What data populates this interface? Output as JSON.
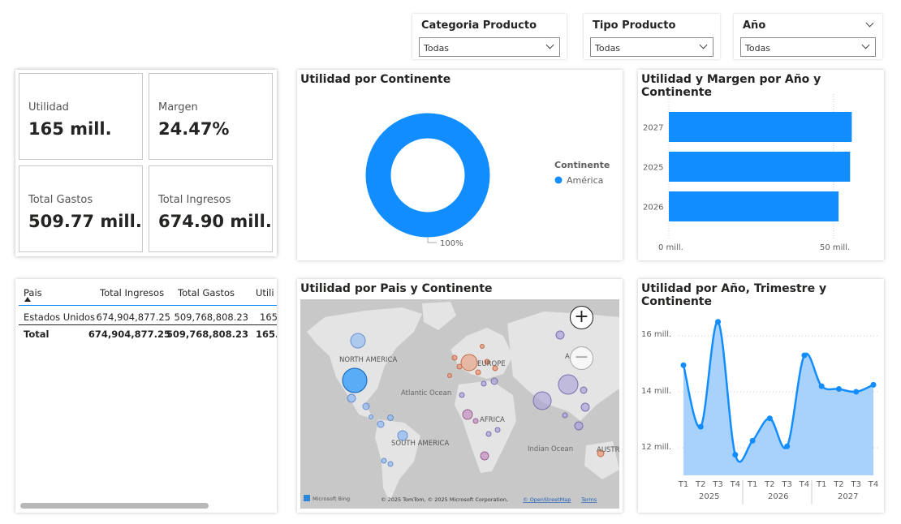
{
  "slicers": [
    {
      "title": "Categoria Producto",
      "value": "Todas"
    },
    {
      "title": "Tipo Producto",
      "value": "Todas"
    },
    {
      "title": "Año",
      "value": "Todas"
    }
  ],
  "kpis": [
    {
      "label": "Utilidad",
      "value": "165 mill."
    },
    {
      "label": "Margen",
      "value": "24.47%"
    },
    {
      "label": "Total Gastos",
      "value": "509.77 mill."
    },
    {
      "label": "Total Ingresos",
      "value": "674.90 mill."
    }
  ],
  "donut": {
    "title": "Utilidad por Continente",
    "legend_title": "Continente",
    "legend_item": "América",
    "pct_label": "100%"
  },
  "bar_chart": {
    "title": "Utilidad y Margen por Año y Continente",
    "x_tick_0": "0 mill.",
    "x_tick_50": "50 mill."
  },
  "table": {
    "headers": [
      "Pais",
      "Total Ingresos",
      "Total Gastos",
      "Utili"
    ],
    "row": [
      "Estados Unidos",
      "674,904,877.25",
      "509,768,808.23",
      "165"
    ],
    "total": [
      "Total",
      "674,904,877.25",
      "509,768,808.23",
      "165."
    ]
  },
  "map": {
    "title": "Utilidad por Pais y Continente",
    "labels": {
      "north_america": "NORTH AMERICA",
      "europe": "EUROPE",
      "atlantic": "Atlantic Ocean",
      "africa": "AFRICA",
      "south_america": "SOUTH AMERICA",
      "indian": "Indian Ocean",
      "austr": "AUSTR",
      "asia_partial": "A"
    },
    "bing": "Microsoft Bing",
    "copyright": "© 2025 TomTom, © 2025 Microsoft Corporation,",
    "osm": "© OpenStreetMap",
    "terms": "Terms"
  },
  "line_chart": {
    "title": "Utilidad por Año, Trimestre y Continente",
    "y_ticks": [
      "16 mill.",
      "14 mill.",
      "12 mill."
    ],
    "quarters": [
      "T1",
      "T2",
      "T3",
      "T4",
      "T1",
      "T2",
      "T3",
      "T4",
      "T1",
      "T2",
      "T3",
      "T4"
    ],
    "years": [
      "2025",
      "2026",
      "2027"
    ]
  },
  "chart_data": [
    {
      "type": "pie",
      "title": "Utilidad por Continente",
      "categories": [
        "América"
      ],
      "values": [
        100
      ],
      "legend": "right"
    },
    {
      "type": "bar",
      "title": "Utilidad y Margen por Año y Continente",
      "orientation": "horizontal",
      "categories": [
        "2027",
        "2025",
        "2026"
      ],
      "values": [
        55.5,
        55.0,
        51.5
      ],
      "xlim": [
        0,
        60
      ],
      "x_ticks": [
        "0 mill.",
        "50 mill."
      ]
    },
    {
      "type": "area",
      "title": "Utilidad por Año, Trimestre y Continente",
      "x": [
        "2025 T1",
        "2025 T2",
        "2025 T3",
        "2025 T4",
        "2026 T1",
        "2026 T2",
        "2026 T3",
        "2026 T4",
        "2027 T1",
        "2027 T2",
        "2027 T3",
        "2027 T4"
      ],
      "values": [
        14.95,
        12.75,
        16.5,
        11.75,
        12.25,
        13.05,
        12.05,
        15.3,
        14.2,
        14.1,
        14.0,
        14.25
      ],
      "ylim": [
        11.0,
        17.0
      ],
      "y_ticks": [
        "16 mill.",
        "14 mill.",
        "12 mill."
      ],
      "color": "#118DFF"
    }
  ],
  "colors": {
    "accent": "#118DFF",
    "area_fill": "#9fcdfb"
  }
}
